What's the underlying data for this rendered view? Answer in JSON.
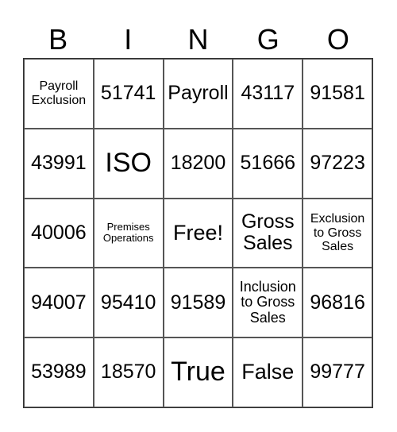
{
  "header": [
    "B",
    "I",
    "N",
    "G",
    "O"
  ],
  "rows": [
    [
      "Payroll Exclusion",
      "51741",
      "Payroll",
      "43117",
      "91581"
    ],
    [
      "43991",
      "ISO",
      "18200",
      "51666",
      "97223"
    ],
    [
      "40006",
      "Premises Operations",
      "Free!",
      "Gross Sales",
      "Exclusion to Gross Sales"
    ],
    [
      "94007",
      "95410",
      "91589",
      "Inclusion to Gross Sales",
      "96816"
    ],
    [
      "53989",
      "18570",
      "True",
      "False",
      "99777"
    ]
  ]
}
